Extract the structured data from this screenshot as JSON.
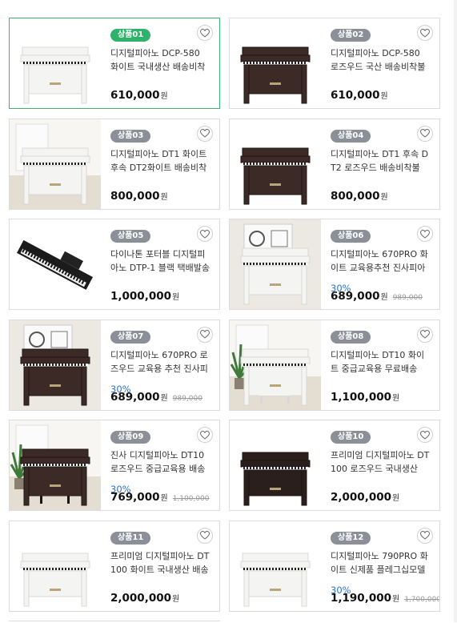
{
  "currency": "원",
  "products": [
    {
      "badge": "상품01",
      "name": "디지털피아노 DCP-580 화이트 국내생산 배송비착불",
      "price": "610,000",
      "discount": "",
      "original": "",
      "selected": true,
      "piano": "white-upright"
    },
    {
      "badge": "상품02",
      "name": "디지털피아노 DCP-580 로즈우드 국산 배송비착불",
      "price": "610,000",
      "discount": "",
      "original": "",
      "selected": false,
      "piano": "rose-upright"
    },
    {
      "badge": "상품03",
      "name": "디지털피아노 DT1 화이트 후속 DT2화이트 배송비착불",
      "price": "800,000",
      "discount": "",
      "original": "",
      "selected": false,
      "piano": "white-room"
    },
    {
      "badge": "상품04",
      "name": "디지털피아노 DT1 후속 DT2 로즈우드 배송비착불",
      "price": "800,000",
      "discount": "",
      "original": "",
      "selected": false,
      "piano": "rose-dt"
    },
    {
      "badge": "상품05",
      "name": "다이나톤 포터블 디지털피아노 DTP-1 블랙 택배발송 무료",
      "price": "1,000,000",
      "discount": "",
      "original": "",
      "selected": false,
      "piano": "portable"
    },
    {
      "badge": "상품06",
      "name": "디지털피아노 670PRO 화이트 교육용추천 진사피아노",
      "price": "689,000",
      "discount": "30%",
      "original": "989,000",
      "selected": false,
      "piano": "white-poster"
    },
    {
      "badge": "상품07",
      "name": "디지털피아노 670PRO 로즈우드 교육용 추천 진사피아노",
      "price": "689,000",
      "discount": "30%",
      "original": "989,000",
      "selected": false,
      "piano": "rose-poster"
    },
    {
      "badge": "상품08",
      "name": "디지털피아노 DT10 화이트 중급교육용 무료배송",
      "price": "1,100,000",
      "discount": "",
      "original": "",
      "selected": false,
      "piano": "white-plant"
    },
    {
      "badge": "상품09",
      "name": "진사 디지털피아노 DT10 로즈우드 중급교육용 배송비착불",
      "price": "769,000",
      "discount": "30%",
      "original": "1,100,000",
      "selected": false,
      "piano": "rose-plant"
    },
    {
      "badge": "상품10",
      "name": "프리미엄 디지털피아노 DT100 로즈우드 국내생산",
      "price": "2,000,000",
      "discount": "",
      "original": "",
      "selected": false,
      "piano": "dark-premium"
    },
    {
      "badge": "상품11",
      "name": "프리미엄 디지털피아노 DT100 화이트 국내생산 배송비",
      "price": "2,000,000",
      "discount": "",
      "original": "",
      "selected": false,
      "piano": "white-premium"
    },
    {
      "badge": "상품12",
      "name": "디지털피아노 790PRO 화이트 신제품 플레그십모델",
      "price": "1,190,000",
      "discount": "30%",
      "original": "1,700,000",
      "selected": false,
      "piano": "white-flagship"
    }
  ]
}
